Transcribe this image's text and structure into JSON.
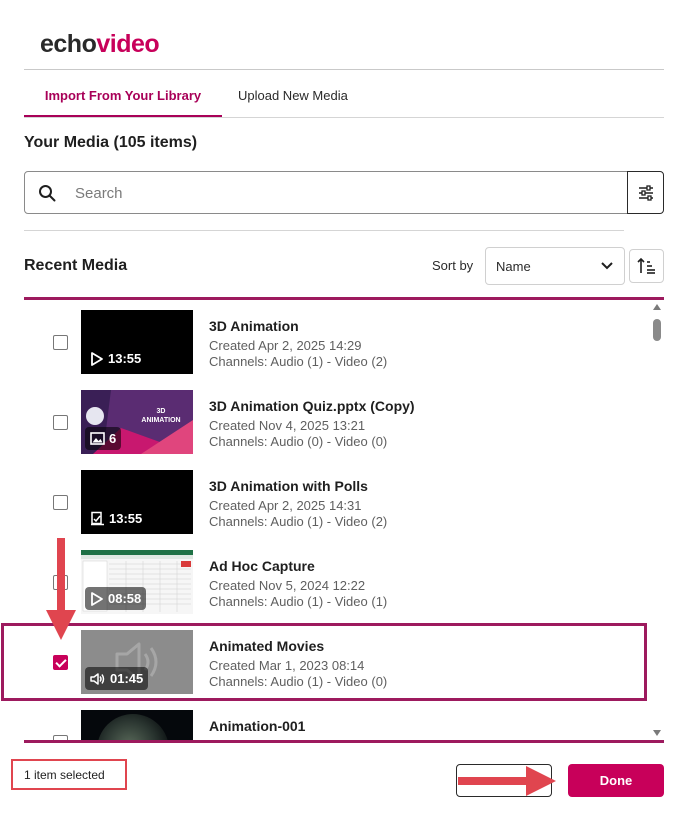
{
  "brand": {
    "logo_part1": "echo",
    "logo_part2": "video"
  },
  "tabs": [
    {
      "label": "Import From Your Library",
      "active": true
    },
    {
      "label": "Upload New Media",
      "active": false
    }
  ],
  "media_header": {
    "title": "Your Media (105 items)"
  },
  "search": {
    "placeholder": "Search",
    "value": ""
  },
  "recent": {
    "title": "Recent Media",
    "sort_label": "Sort by",
    "sort_value": "Name"
  },
  "items": [
    {
      "title": "3D Animation",
      "created": "Created Apr 2, 2025 14:29",
      "channels": "Channels: Audio (1) - Video (2)",
      "badge": "13:55",
      "badge_icon": "play-icon",
      "checked": false
    },
    {
      "title": "3D Animation Quiz.pptx (Copy)",
      "created": "Created Nov 4, 2025 13:21",
      "channels": "Channels: Audio (0) - Video (0)",
      "badge": "6",
      "badge_icon": "image-icon",
      "thumb_text": "3D\nANIMATION",
      "checked": false
    },
    {
      "title": "3D Animation with Polls",
      "created": "Created Apr 2, 2025 14:31",
      "channels": "Channels: Audio (1) - Video (2)",
      "badge": "13:55",
      "badge_icon": "quiz-icon",
      "checked": false
    },
    {
      "title": "Ad Hoc Capture",
      "created": "Created Nov 5, 2024 12:22",
      "channels": "Channels: Audio (1) - Video (1)",
      "badge": "08:58",
      "badge_icon": "play-icon",
      "checked": false
    },
    {
      "title": "Animated Movies",
      "created": "Created Mar 1, 2023 08:14",
      "channels": "Channels: Audio (1) - Video (0)",
      "badge": "01:45",
      "badge_icon": "speaker-icon",
      "checked": true
    },
    {
      "title": "Animation-001",
      "created": "",
      "channels": "",
      "checked": false
    }
  ],
  "footer": {
    "selected_text": "1 item selected",
    "done_label": "Done",
    "cancel_label": ""
  },
  "colors": {
    "accent": "#c8005a",
    "accent_dark": "#9d1a5e",
    "annotation_red": "#e0454f"
  }
}
